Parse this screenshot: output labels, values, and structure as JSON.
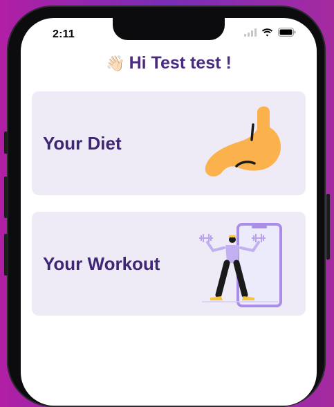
{
  "status_bar": {
    "time": "2:11"
  },
  "header": {
    "wave_emoji": "👋🏻",
    "greeting": "Hi Test test !"
  },
  "cards": [
    {
      "label": "Your Diet",
      "illustration": "stomach-illustration"
    },
    {
      "label": "Your Workout",
      "illustration": "workout-illustration"
    }
  ],
  "colors": {
    "text_primary": "#3e2675",
    "card_bg": "#eeebf6",
    "stomach": "#fbb24c",
    "workout_accent": "#a98de8"
  }
}
